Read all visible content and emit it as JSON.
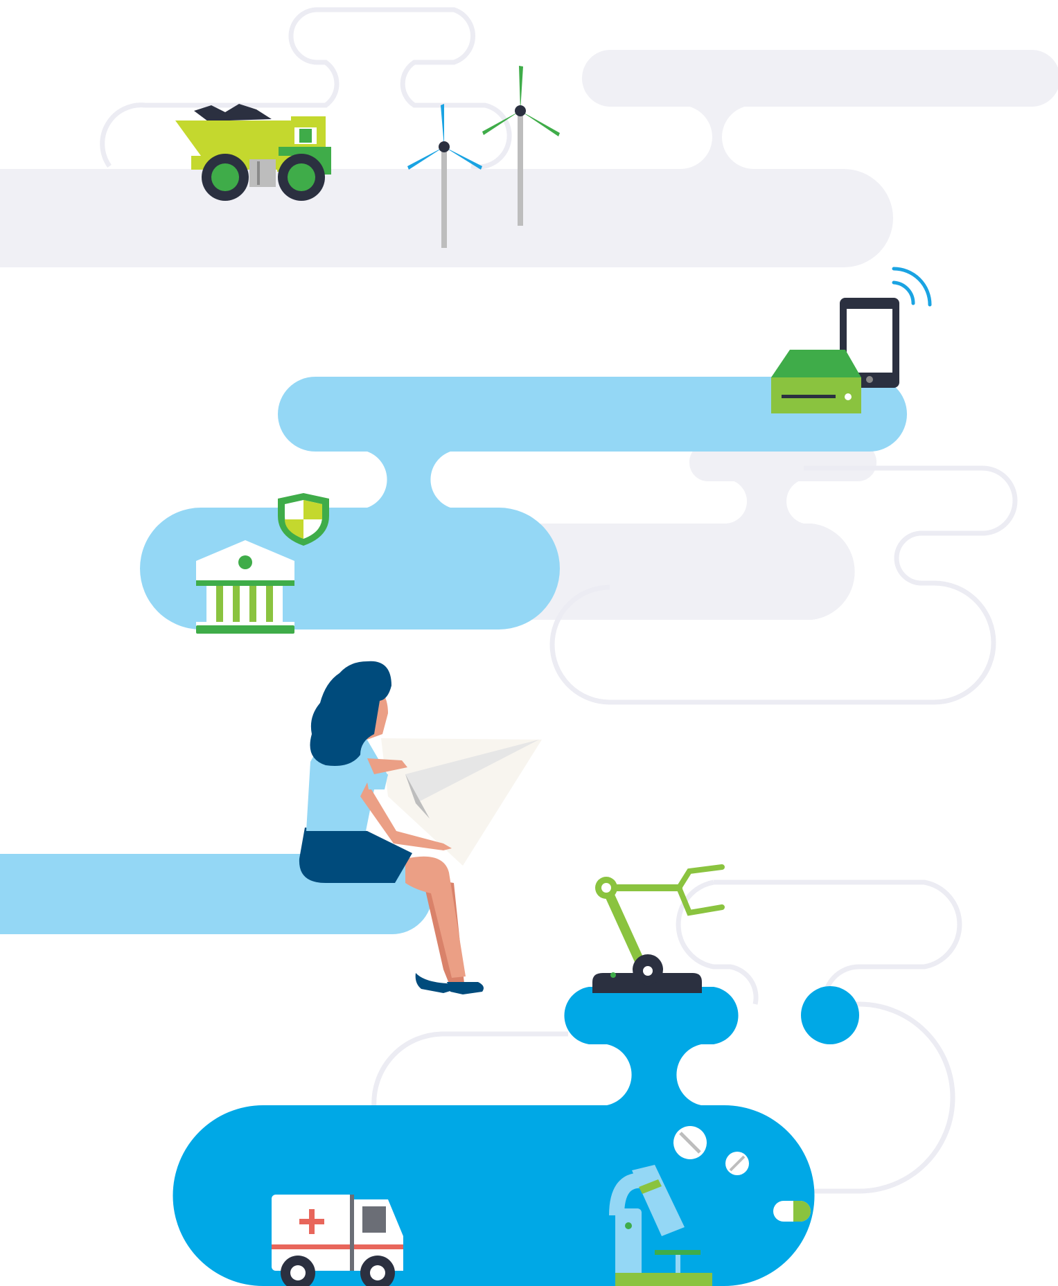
{
  "colors": {
    "background": "#ffffff",
    "cloud_gray": "#f0f0f5",
    "outline_gray": "#ececf3",
    "cloud_light_blue": "#94d7f5",
    "cloud_blue": "#00a8e6",
    "lime": "#c4d82e",
    "green": "#3fac49",
    "light_green": "#8ac33f",
    "dark": "#2b3040",
    "navy": "#004b7c",
    "skin": "#eb9f85",
    "shirt": "#94d7f5",
    "red": "#e8665b",
    "paper": "#f8f5ef",
    "turbine_pole": "#bdbdbd",
    "turbine_blue_blade": "#1aa3e2"
  },
  "scene": {
    "sections": [
      {
        "name": "industry",
        "icons": [
          "dump-truck-icon",
          "wind-turbine-icon",
          "wind-turbine-icon"
        ]
      },
      {
        "name": "technology",
        "icons": [
          "server-box-icon",
          "smartphone-icon",
          "wifi-signal-icon"
        ]
      },
      {
        "name": "finance",
        "icons": [
          "bank-icon",
          "security-shield-icon"
        ]
      },
      {
        "name": "person",
        "icons": [
          "woman-figure",
          "paper-plane-icon"
        ]
      },
      {
        "name": "manufacturing",
        "icons": [
          "robotic-arm-icon"
        ]
      },
      {
        "name": "healthcare",
        "icons": [
          "ambulance-icon",
          "microscope-icon",
          "pill-icon",
          "capsule-icon"
        ]
      }
    ]
  }
}
